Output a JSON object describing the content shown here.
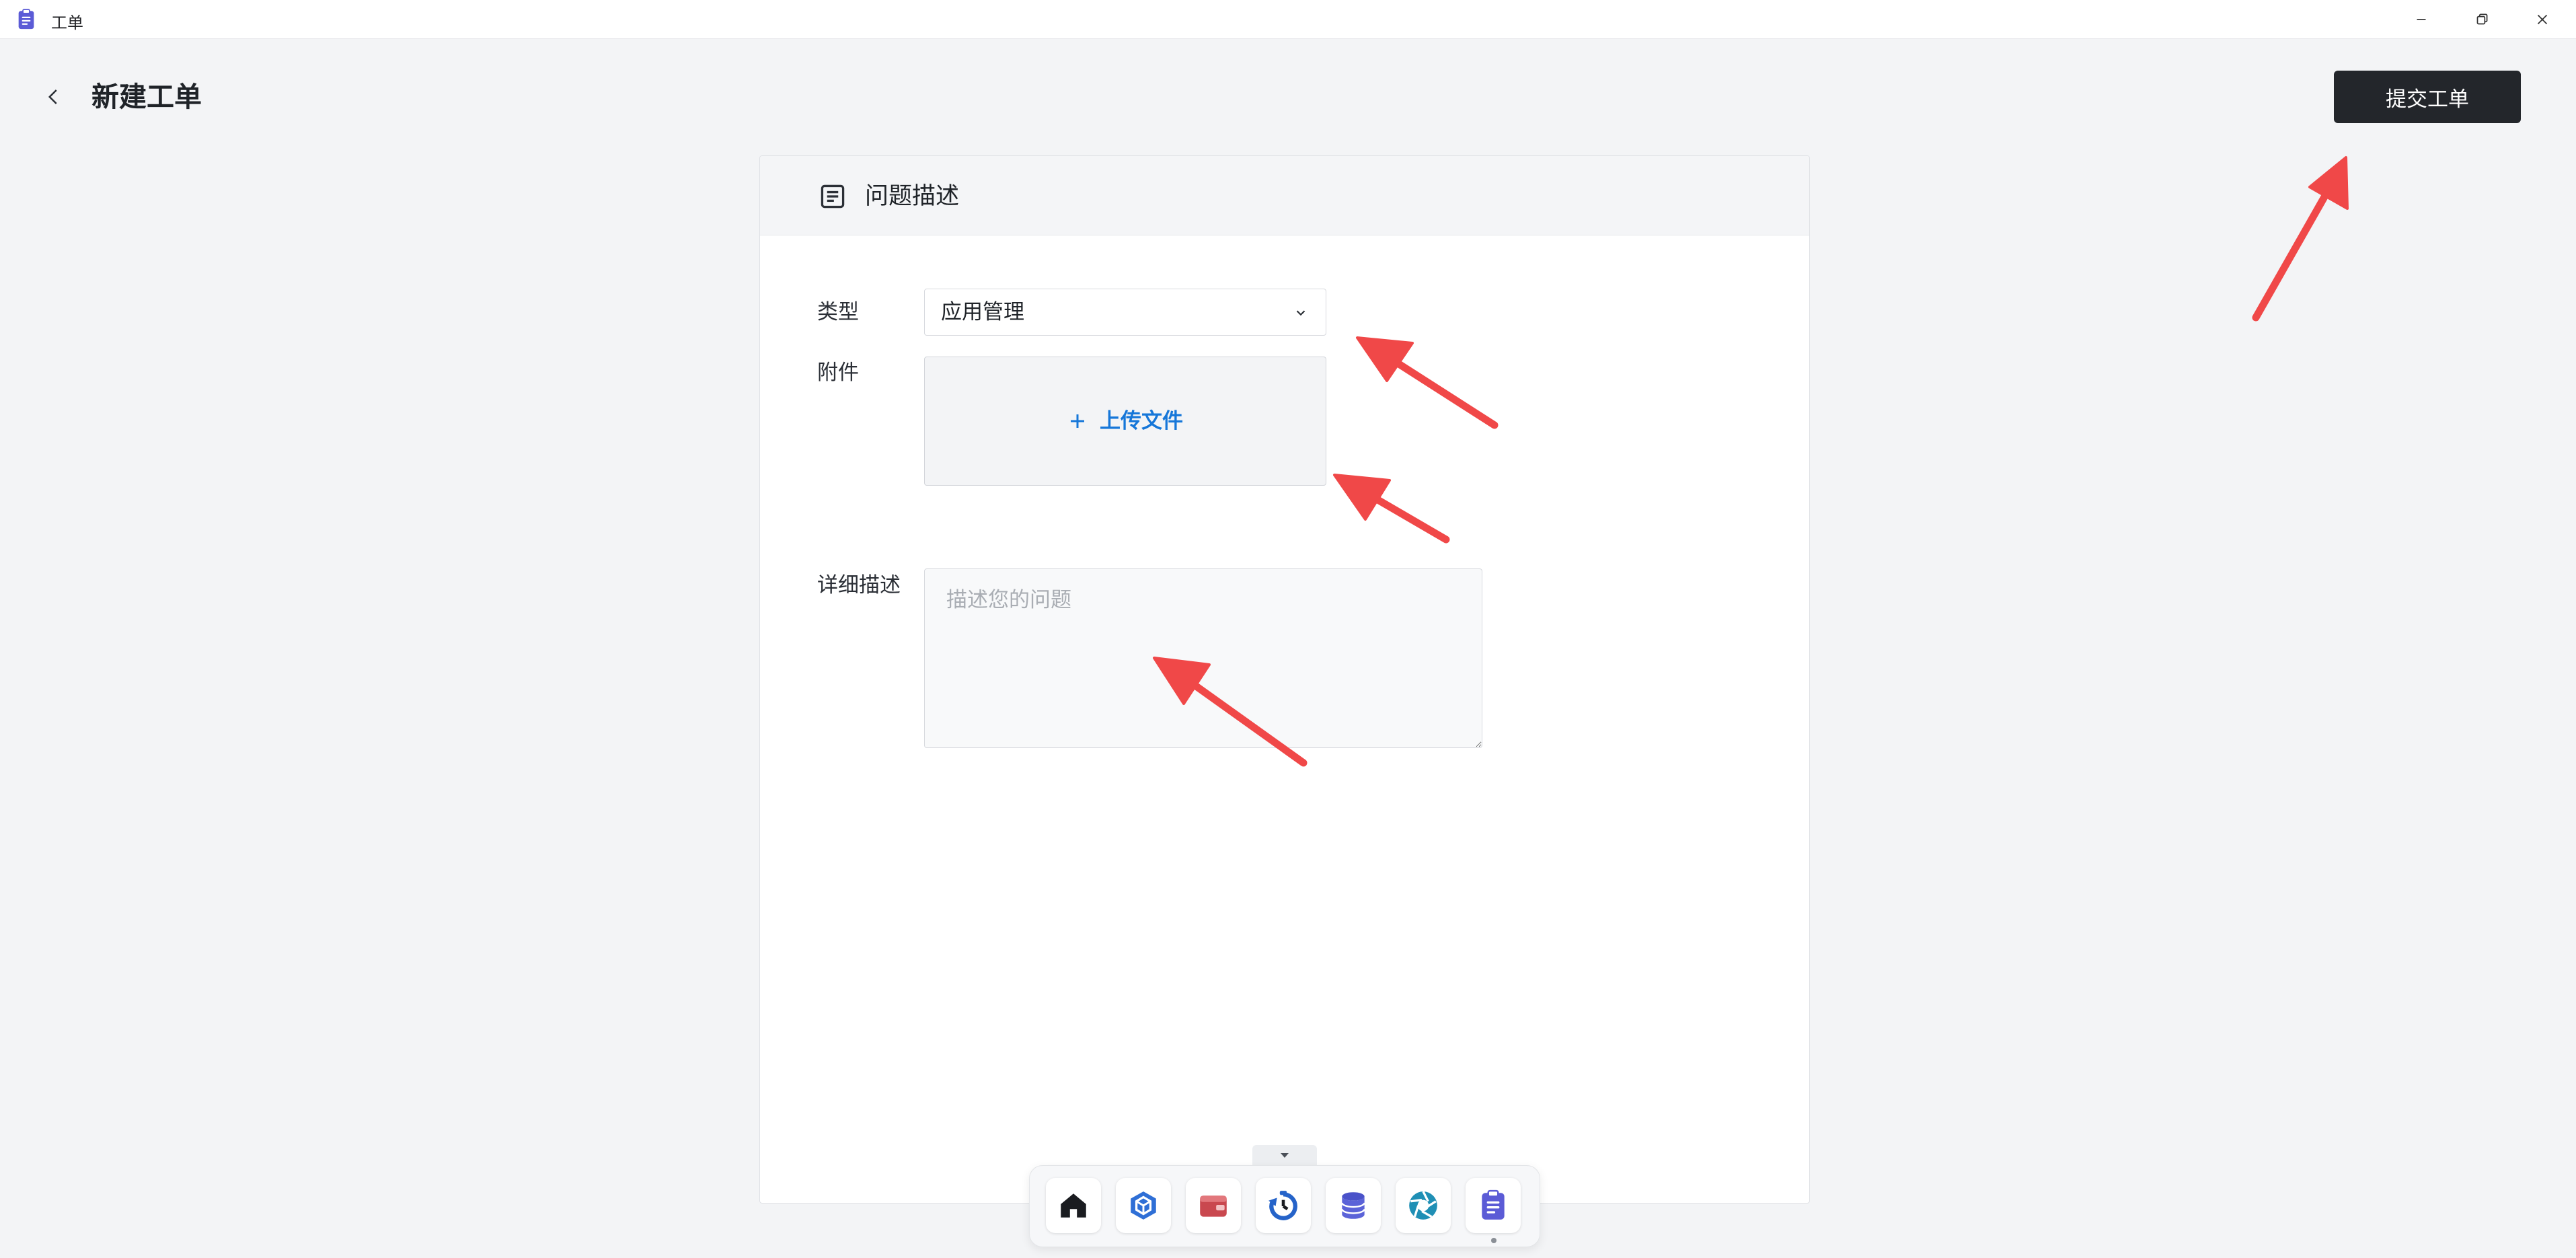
{
  "window": {
    "title": "工单",
    "icon": "clipboard-icon"
  },
  "header": {
    "title": "新建工单",
    "submit_label": "提交工单"
  },
  "card": {
    "title": "问题描述",
    "fields": {
      "type_label": "类型",
      "type_value": "应用管理",
      "attachment_label": "附件",
      "upload_label": "上传文件",
      "detail_label": "详细描述",
      "detail_placeholder": "描述您的问题"
    }
  },
  "dock": {
    "items": [
      "home-icon",
      "package-icon",
      "wallet-icon",
      "backup-icon",
      "database-icon",
      "aperture-icon",
      "clipboard-icon"
    ]
  },
  "colors": {
    "accent": "#1677d9",
    "submit_bg": "#23262b",
    "annotation_arrow": "#f04848",
    "app_icon": "#5b5bd6"
  }
}
